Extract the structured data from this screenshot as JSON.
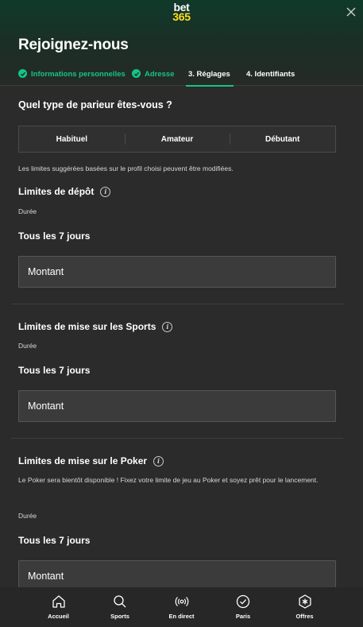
{
  "brand": {
    "line1": "bet",
    "line2": "365"
  },
  "title": "Rejoignez-nous",
  "steps": [
    {
      "label": "Informations personnelles",
      "state": "done"
    },
    {
      "label": "Adresse",
      "state": "done"
    },
    {
      "label": "3. Réglages",
      "state": "active"
    },
    {
      "label": "4. Identifiants",
      "state": "todo"
    }
  ],
  "profile": {
    "question": "Quel type de parieur êtes-vous ?",
    "options": [
      "Habituel",
      "Amateur",
      "Débutant"
    ],
    "note": "Les limites suggérées basées sur le profil choisi peuvent être modifiées."
  },
  "deposit": {
    "title": "Limites de dépôt",
    "duration_label": "Durée",
    "period": "Tous les 7 jours",
    "amount_placeholder": "Montant"
  },
  "sports": {
    "title": "Limites de mise sur les Sports",
    "duration_label": "Durée",
    "period": "Tous les 7 jours",
    "amount_placeholder": "Montant"
  },
  "poker": {
    "title": "Limites de mise sur le Poker",
    "note": "Le Poker sera bientôt disponible ! Fixez votre limite de jeu au Poker et soyez prêt pour le lancement.",
    "duration_label": "Durée",
    "period": "Tous les 7 jours",
    "amount_placeholder": "Montant"
  },
  "nav": [
    {
      "label": "Accueil",
      "icon": "home-icon"
    },
    {
      "label": "Sports",
      "icon": "search-icon"
    },
    {
      "label": "En direct",
      "icon": "live-broadcast-icon"
    },
    {
      "label": "Paris",
      "icon": "check-circle-icon"
    },
    {
      "label": "Offres",
      "icon": "offers-badge-icon"
    }
  ],
  "colors": {
    "accent": "#14c486",
    "logo_yellow": "#ffdf1b",
    "background": "#2a2b2a"
  }
}
